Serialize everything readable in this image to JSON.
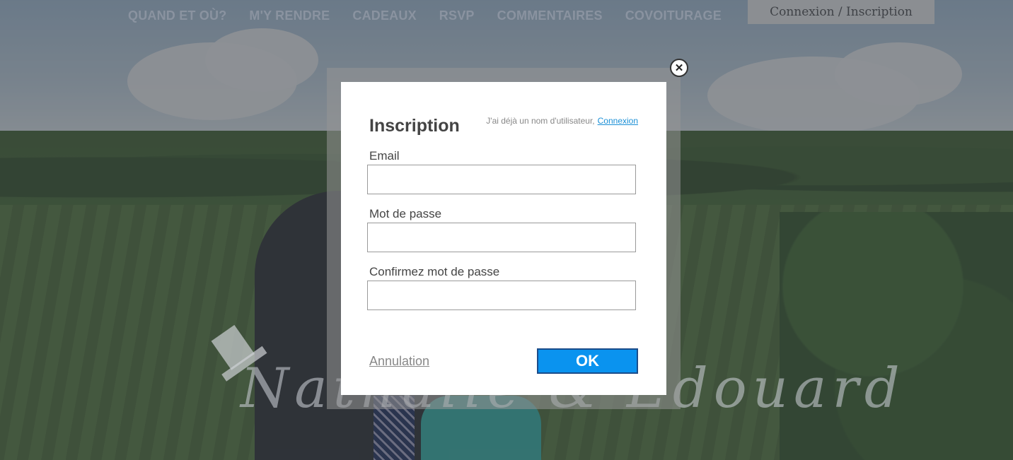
{
  "nav": {
    "items": [
      {
        "label": "QUAND ET OÙ?"
      },
      {
        "label": "M'Y RENDRE"
      },
      {
        "label": "CADEAUX"
      },
      {
        "label": "RSVP"
      },
      {
        "label": "COMMENTAIRES"
      },
      {
        "label": "COVOITURAGE"
      }
    ],
    "login_label": "Connexion / Inscription"
  },
  "logo": {
    "text": "Nathalie & Edouard"
  },
  "modal": {
    "title": "Inscription",
    "switch_prompt": "J'ai déjà un nom d'utilisateur,",
    "switch_link": "Connexion",
    "fields": [
      {
        "label": "Email",
        "value": ""
      },
      {
        "label": "Mot de passe",
        "value": ""
      },
      {
        "label": "Confirmez mot de passe",
        "value": ""
      }
    ],
    "cancel_label": "Annulation",
    "ok_label": "OK",
    "close_icon": "close-icon"
  },
  "colors": {
    "accent": "#0a93ef",
    "link": "#1a8fd6",
    "nav_text": "#8a93a0"
  }
}
